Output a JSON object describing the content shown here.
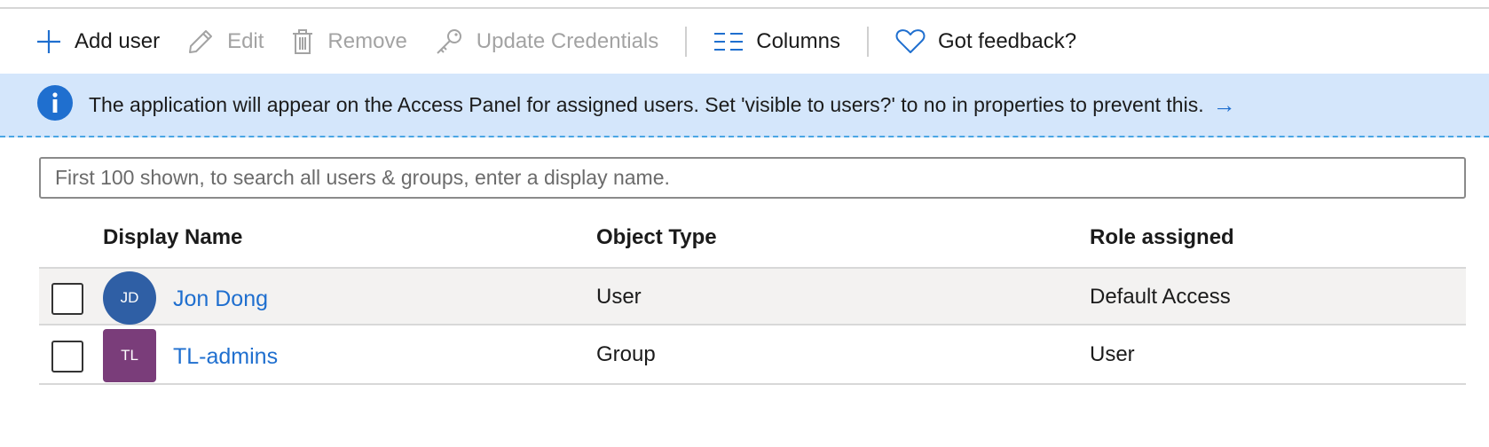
{
  "toolbar": {
    "add_user": "Add user",
    "edit": "Edit",
    "remove": "Remove",
    "update_credentials": "Update Credentials",
    "columns": "Columns",
    "feedback": "Got feedback?"
  },
  "icons": {
    "add": "plus-icon",
    "edit": "pencil-icon",
    "remove": "trash-icon",
    "credentials": "key-icon",
    "columns": "columns-icon",
    "feedback": "heart-icon",
    "info": "info-icon",
    "arrow": "arrow-right-icon"
  },
  "banner": {
    "message": "The application will appear on the Access Panel for assigned users. Set 'visible to users?' to no in properties to prevent this.",
    "arrow": "→"
  },
  "search": {
    "placeholder": "First 100 shown, to search all users & groups, enter a display name.",
    "value": ""
  },
  "table": {
    "headers": [
      "Display Name",
      "Object Type",
      "Role assigned"
    ],
    "rows": [
      {
        "initials": "JD",
        "name": "Jon Dong",
        "type": "User",
        "role": "Default Access",
        "avatar_color": "#2f5fa5"
      },
      {
        "initials": "TL",
        "name": "TL-admins",
        "type": "Group",
        "role": "User",
        "avatar_color": "#7a3d7a"
      }
    ]
  },
  "colors": {
    "accent": "#1f6fcf",
    "banner_bg": "#d4e6fb",
    "disabled_text": "#a3a3a3"
  }
}
